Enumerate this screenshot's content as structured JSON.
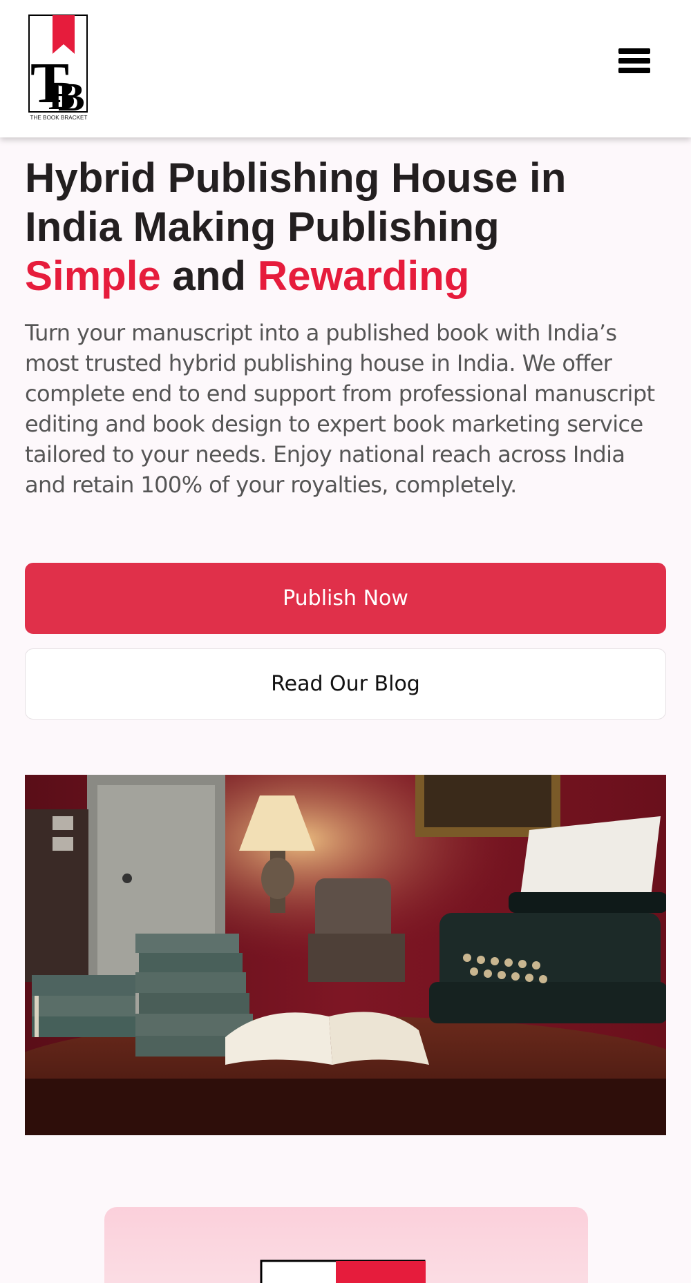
{
  "header": {
    "logo_icon": "tbb-logo-icon",
    "logo_tagline": "THE BOOK BRACKET",
    "menu_icon": "hamburger-menu-icon"
  },
  "hero": {
    "title_line1": "Hybrid Publishing House in",
    "title_line2": "India Making Publishing",
    "title_word_simple": "Simple",
    "title_word_and": " and ",
    "title_word_rewarding": "Rewarding",
    "description": "Turn your manuscript into a published book with India’s most trusted hybrid publishing house in India. We offer complete end to end support from professional manuscript editing and book design to expert book marketing service tailored to your needs. Enjoy national reach across India and retain 100% of your royalties, completely.",
    "primary_button": "Publish Now",
    "secondary_button": "Read Our Blog",
    "image_icon": "vintage-study-typewriter-books-image"
  },
  "colors": {
    "accent": "#e61c3c",
    "button_primary": "#e0304a",
    "heading": "#231f20",
    "body_text": "#555555",
    "page_background": "#fdf8fb"
  }
}
